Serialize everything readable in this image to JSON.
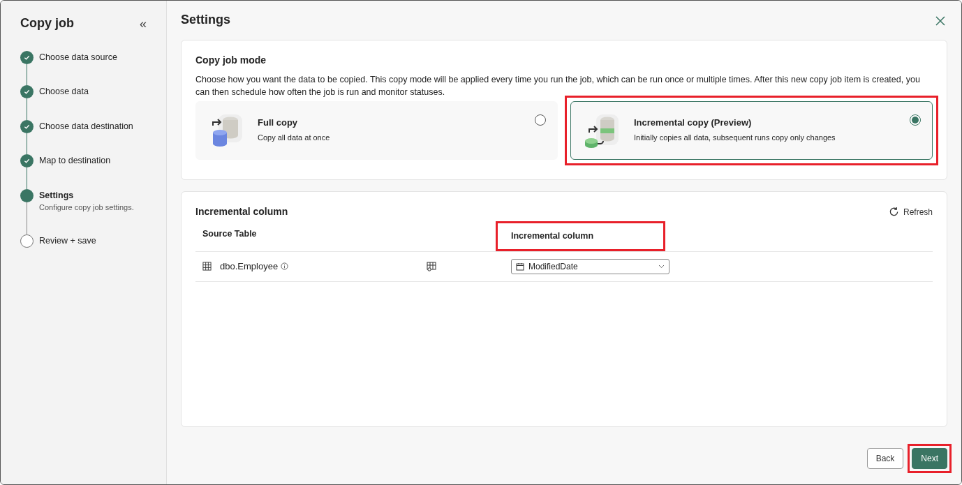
{
  "sidebar": {
    "title": "Copy job",
    "collapse_glyph": "«",
    "steps": [
      {
        "label": "Choose data source",
        "completed": true,
        "selected": false
      },
      {
        "label": "Choose data",
        "completed": true,
        "selected": false
      },
      {
        "label": "Choose data destination",
        "completed": true,
        "selected": false
      },
      {
        "label": "Map to destination",
        "completed": true,
        "selected": false
      },
      {
        "label": "Settings",
        "completed": false,
        "selected": true,
        "description": "Configure copy job settings."
      },
      {
        "label": "Review + save",
        "completed": false,
        "selected": false
      }
    ]
  },
  "header": {
    "title": "Settings"
  },
  "mode_card": {
    "title": "Copy job mode",
    "description": "Choose how you want the data to be copied. This copy mode will be applied every time you run the job, which can be run once or multiple times. After this new copy job item is created, you can then schedule how often the job is run and monitor statuses.",
    "options": [
      {
        "kind": "full",
        "title": "Full copy",
        "subtitle": "Copy all data at once",
        "selected": false,
        "highlighted": false
      },
      {
        "kind": "incremental",
        "title": "Incremental copy (Preview)",
        "subtitle": "Initially copies all data, subsequent runs copy only changes",
        "selected": true,
        "highlighted": true
      }
    ]
  },
  "column_card": {
    "title": "Incremental column",
    "refresh_label": "Refresh",
    "columns": [
      {
        "label": "Source Table",
        "highlighted": false
      },
      {
        "label": "Incremental column",
        "highlighted": true
      }
    ],
    "rows": [
      {
        "table": "dbo.Employee",
        "column_value": "ModifiedDate"
      }
    ]
  },
  "footer": {
    "buttons": [
      {
        "label": "Back",
        "kind": "secondary",
        "highlighted": false
      },
      {
        "label": "Next",
        "kind": "primary",
        "highlighted": true
      }
    ]
  }
}
